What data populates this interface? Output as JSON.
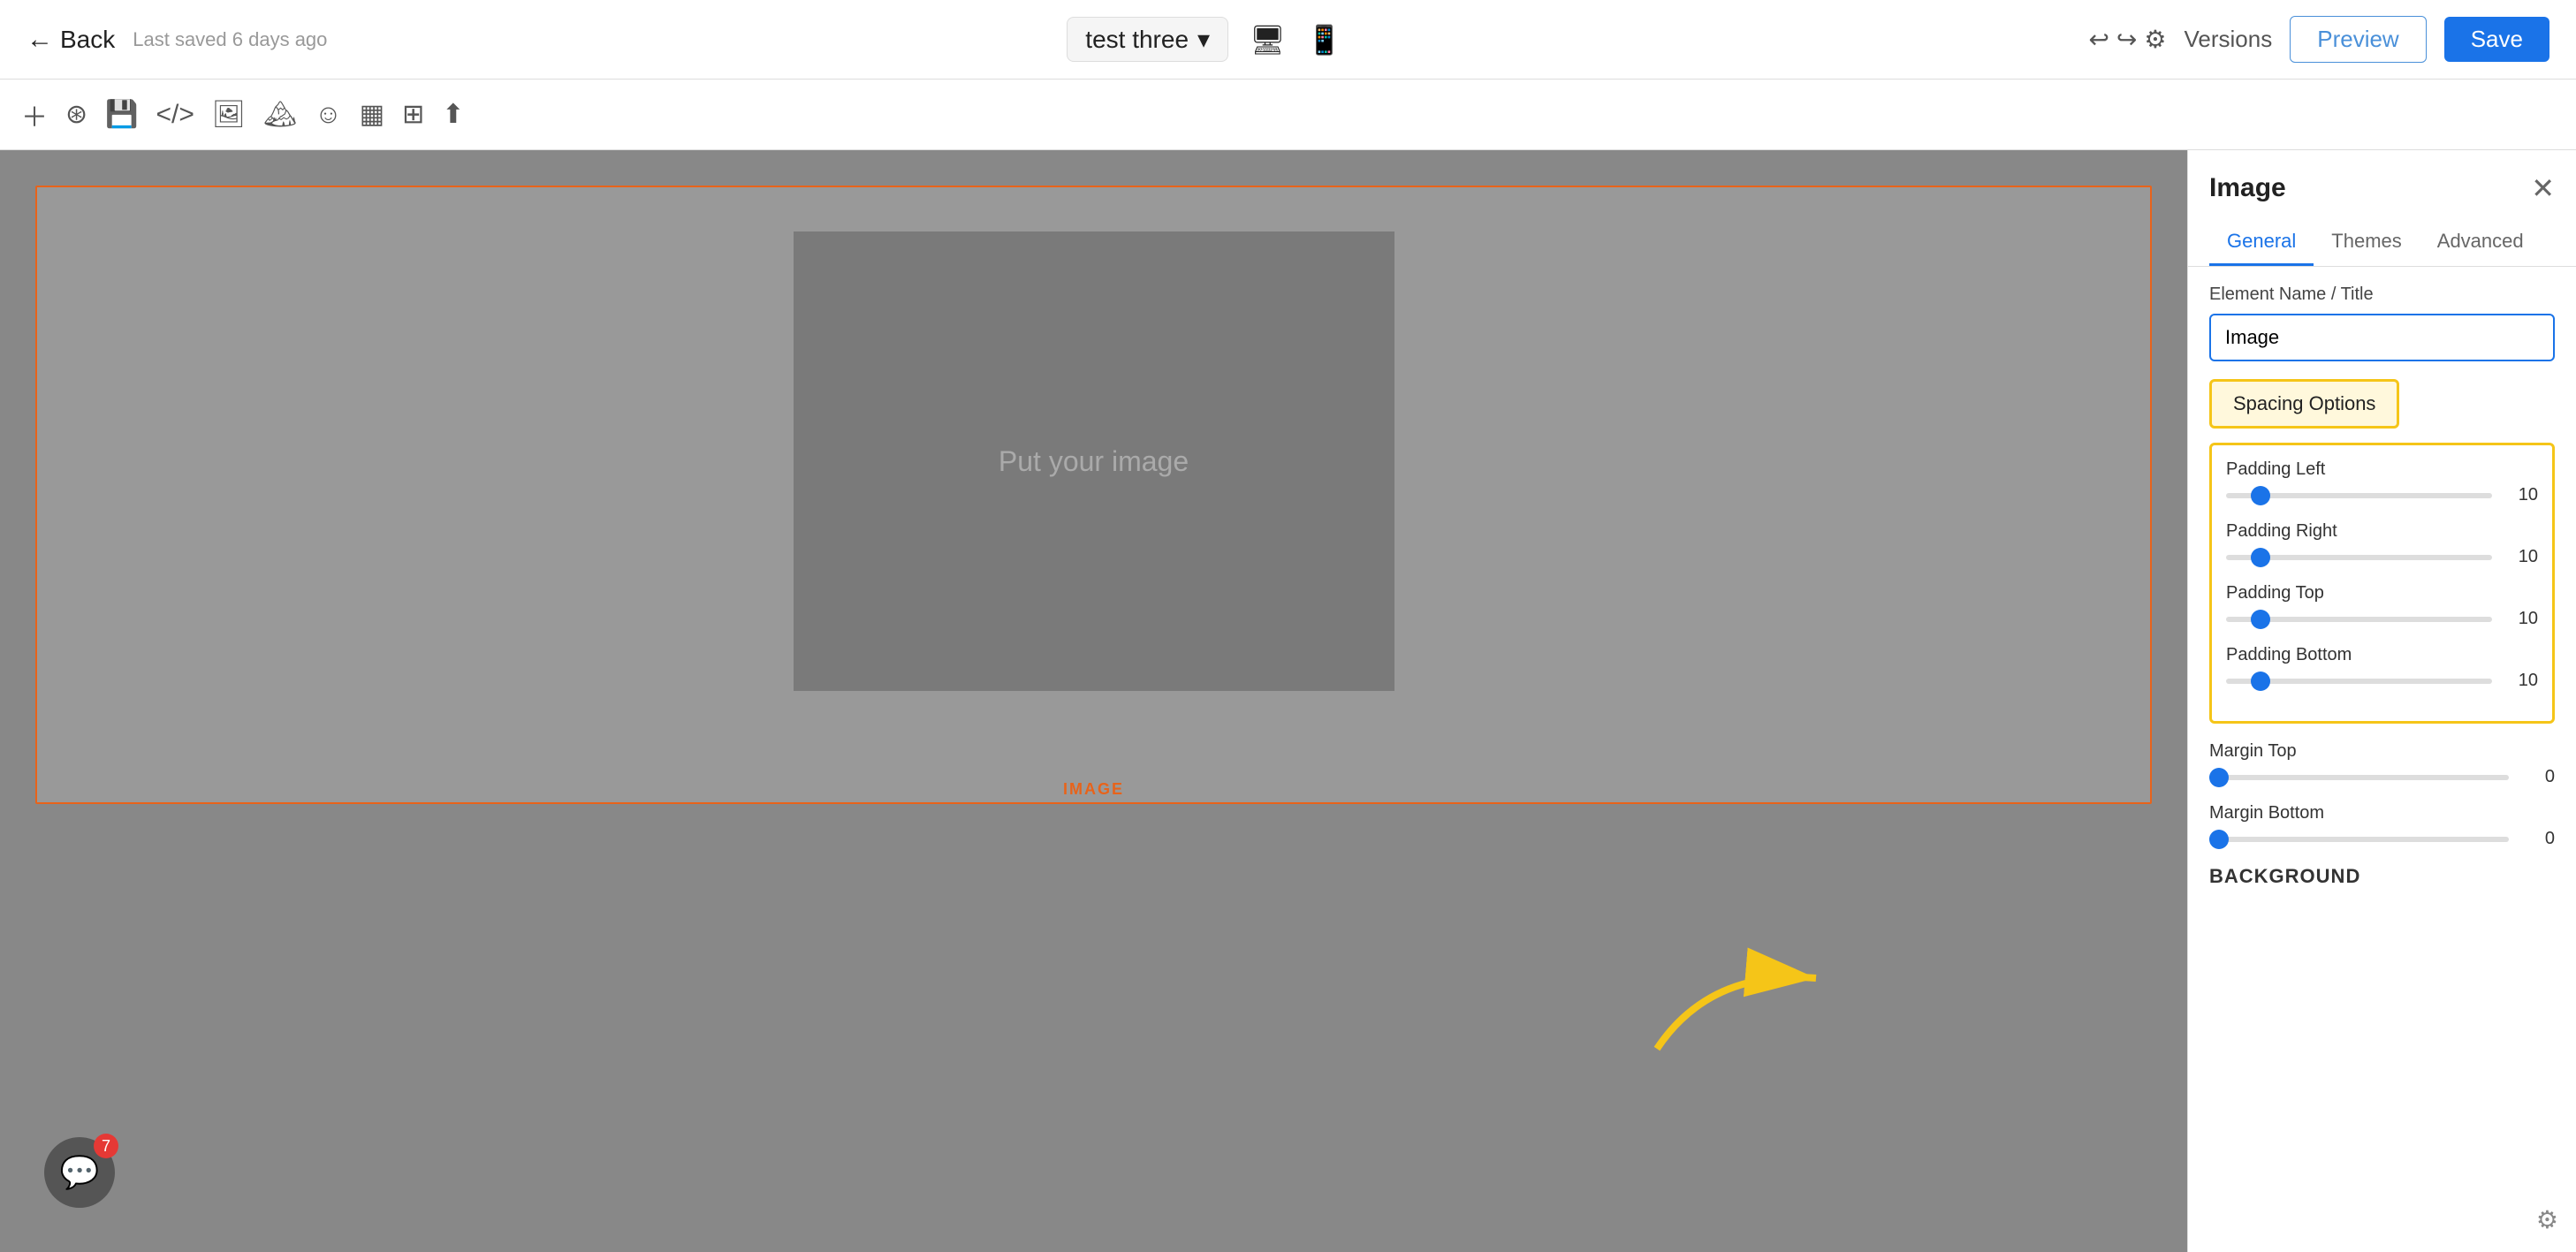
{
  "header": {
    "back_label": "Back",
    "last_saved": "Last saved 6 days ago",
    "project_name": "test three",
    "versions_label": "Versions",
    "preview_label": "Preview",
    "save_label": "Save"
  },
  "toolbar": {
    "icons": [
      "plus",
      "layers",
      "save",
      "code",
      "desktop",
      "image",
      "grid",
      "view",
      "export"
    ]
  },
  "canvas": {
    "image_placeholder_text": "Put your image",
    "image_label": "IMAGE"
  },
  "panel": {
    "title": "Image",
    "tabs": [
      "General",
      "Themes",
      "Advanced"
    ],
    "active_tab": "General",
    "element_name_label": "Element Name / Title",
    "element_name_value": "Image",
    "spacing_options_label": "Spacing Options",
    "padding_left_label": "Padding Left",
    "padding_left_value": "10",
    "padding_right_label": "Padding Right",
    "padding_right_value": "10",
    "padding_top_label": "Padding Top",
    "padding_top_value": "10",
    "padding_bottom_label": "Padding Bottom",
    "padding_bottom_value": "10",
    "margin_top_label": "Margin Top",
    "margin_top_value": "0",
    "margin_bottom_label": "Margin Bottom",
    "margin_bottom_value": "0",
    "background_label": "BACKGROUND"
  },
  "chat": {
    "badge_count": "7"
  }
}
